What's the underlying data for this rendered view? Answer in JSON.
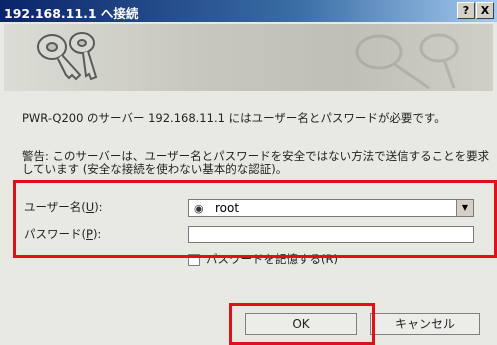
{
  "window": {
    "title": "192.168.11.1 へ接続",
    "help_button": "?",
    "close_button": "X"
  },
  "message": {
    "line1": "PWR-Q200 のサーバー 192.168.11.1 にはユーザー名とパスワードが必要です。",
    "line2": "警告: このサーバーは、ユーザー名とパスワードを安全ではない方法で送信することを要求しています (安全な接続を使わない基本的な認証)。"
  },
  "form": {
    "username_label": "ユーザー名(",
    "username_key": "U",
    "username_label_end": "):",
    "username_value": "root",
    "password_label": "パスワード(",
    "password_key": "P",
    "password_label_end": "):",
    "password_value": "",
    "remember_label": "パスワードを記憶する(R)",
    "remember_checked": false
  },
  "buttons": {
    "ok": "OK",
    "cancel": "キャンセル"
  },
  "highlight_color": "#e0101a"
}
